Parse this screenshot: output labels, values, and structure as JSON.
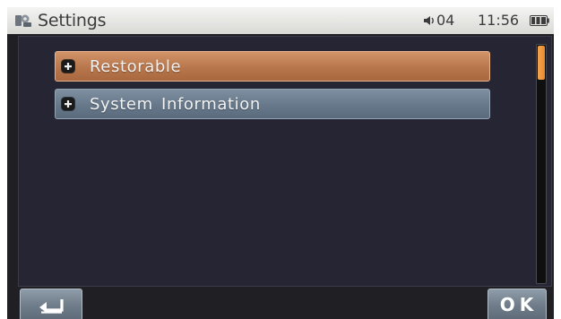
{
  "header": {
    "title": "Settings",
    "app_icon": "settings-icon",
    "volume_icon": "speaker-icon",
    "volume": "04",
    "time": "11:56",
    "battery_icon": "battery-icon"
  },
  "menu": {
    "items": [
      {
        "label": "Restorable",
        "icon": "plus-icon",
        "selected": true
      },
      {
        "label": "System Information",
        "icon": "plus-icon",
        "selected": false
      }
    ]
  },
  "scrollbar": {
    "position": 0
  },
  "footer": {
    "back_icon": "back-arrow-icon",
    "ok_label": "OK"
  },
  "colors": {
    "selected": "#b8764c",
    "normal": "#66788a",
    "background": "#252533",
    "scroll_thumb": "#e88a2a"
  }
}
